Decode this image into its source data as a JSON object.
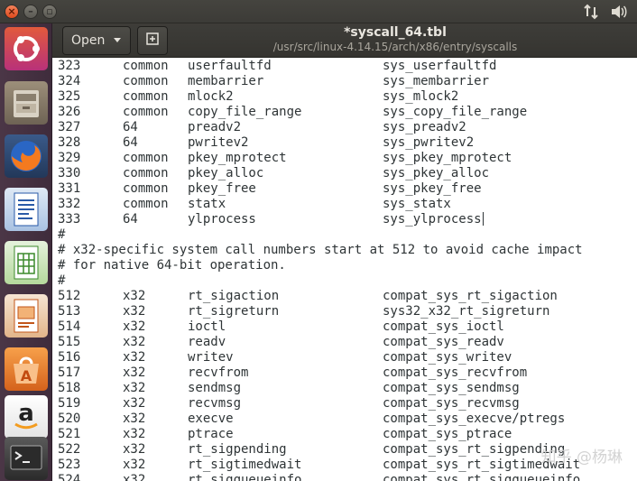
{
  "window": {
    "title": "*syscall_64.tbl",
    "path": "/usr/src/linux-4.14.15/arch/x86/entry/syscalls"
  },
  "toolbar": {
    "open_label": "Open"
  },
  "tray": {
    "icons": [
      "network-arrows-icon",
      "volume-icon"
    ]
  },
  "launcher": {
    "items": [
      "ubuntu-dash-icon",
      "files-icon",
      "firefox-icon",
      "writer-icon",
      "calc-icon",
      "impress-icon",
      "software-center-icon",
      "amazon-icon",
      "terminal-icon"
    ]
  },
  "editor": {
    "lines": [
      {
        "num": "323",
        "abi": "common",
        "name": "userfaultfd",
        "entry": "sys_userfaultfd"
      },
      {
        "num": "324",
        "abi": "common",
        "name": "membarrier",
        "entry": "sys_membarrier"
      },
      {
        "num": "325",
        "abi": "common",
        "name": "mlock2",
        "entry": "sys_mlock2"
      },
      {
        "num": "326",
        "abi": "common",
        "name": "copy_file_range",
        "entry": "sys_copy_file_range"
      },
      {
        "num": "327",
        "abi": "64",
        "name": "preadv2",
        "entry": "sys_preadv2"
      },
      {
        "num": "328",
        "abi": "64",
        "name": "pwritev2",
        "entry": "sys_pwritev2"
      },
      {
        "num": "329",
        "abi": "common",
        "name": "pkey_mprotect",
        "entry": "sys_pkey_mprotect"
      },
      {
        "num": "330",
        "abi": "common",
        "name": "pkey_alloc",
        "entry": "sys_pkey_alloc"
      },
      {
        "num": "331",
        "abi": "common",
        "name": "pkey_free",
        "entry": "sys_pkey_free"
      },
      {
        "num": "332",
        "abi": "common",
        "name": "statx",
        "entry": "sys_statx"
      },
      {
        "num": "333",
        "abi": "64",
        "name": "ylprocess",
        "entry": "sys_ylprocess"
      },
      {
        "text": "#"
      },
      {
        "text": "# x32-specific system call numbers start at 512 to avoid cache impact"
      },
      {
        "text": "# for native 64-bit operation."
      },
      {
        "text": "#"
      },
      {
        "num": "512",
        "abi": "x32",
        "name": "rt_sigaction",
        "entry": "compat_sys_rt_sigaction"
      },
      {
        "num": "513",
        "abi": "x32",
        "name": "rt_sigreturn",
        "entry": "sys32_x32_rt_sigreturn"
      },
      {
        "num": "514",
        "abi": "x32",
        "name": "ioctl",
        "entry": "compat_sys_ioctl"
      },
      {
        "num": "515",
        "abi": "x32",
        "name": "readv",
        "entry": "compat_sys_readv"
      },
      {
        "num": "516",
        "abi": "x32",
        "name": "writev",
        "entry": "compat_sys_writev"
      },
      {
        "num": "517",
        "abi": "x32",
        "name": "recvfrom",
        "entry": "compat_sys_recvfrom"
      },
      {
        "num": "518",
        "abi": "x32",
        "name": "sendmsg",
        "entry": "compat_sys_sendmsg"
      },
      {
        "num": "519",
        "abi": "x32",
        "name": "recvmsg",
        "entry": "compat_sys_recvmsg"
      },
      {
        "num": "520",
        "abi": "x32",
        "name": "execve",
        "entry": "compat_sys_execve/ptregs"
      },
      {
        "num": "521",
        "abi": "x32",
        "name": "ptrace",
        "entry": "compat_sys_ptrace"
      },
      {
        "num": "522",
        "abi": "x32",
        "name": "rt_sigpending",
        "entry": "compat_sys_rt_sigpending"
      },
      {
        "num": "523",
        "abi": "x32",
        "name": "rt_sigtimedwait",
        "entry": "compat_sys_rt_sigtimedwait"
      },
      {
        "num": "524",
        "abi": "x32",
        "name": "rt_sigqueueinfo",
        "entry": "compat_sys_rt_sigqueueinfo"
      }
    ],
    "watermark": "知乎 @杨琳"
  }
}
